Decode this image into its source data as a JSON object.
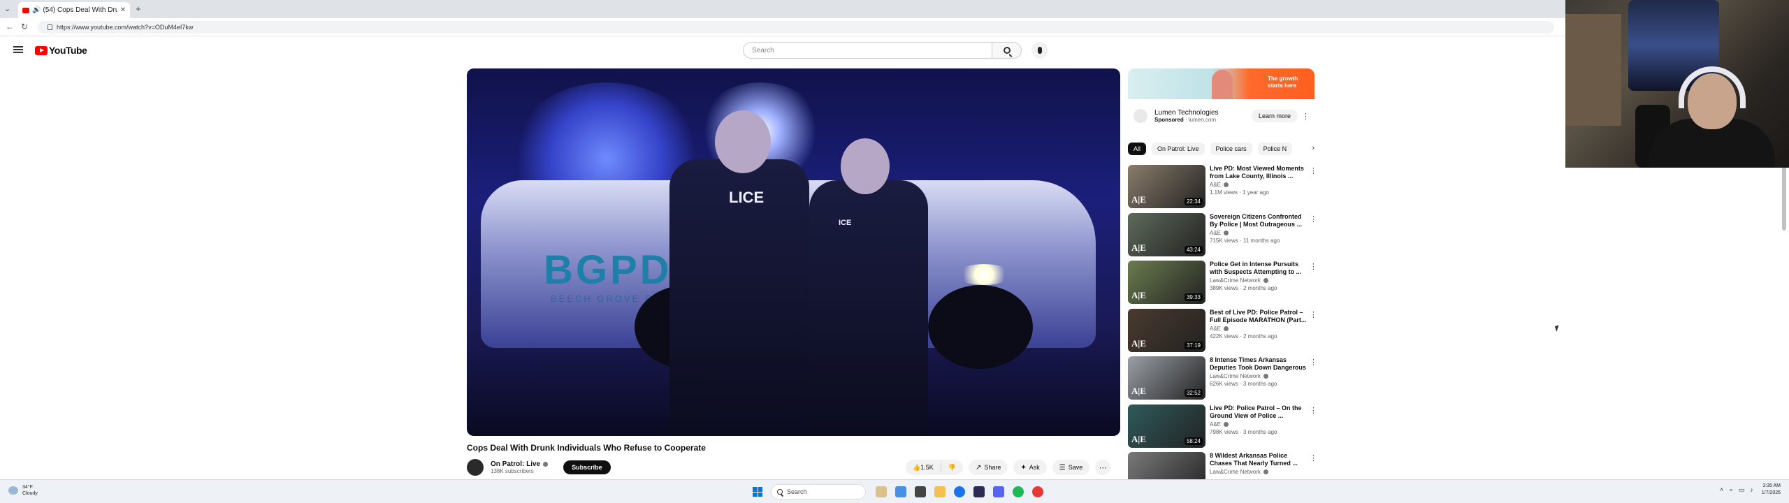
{
  "browser": {
    "tab_title": "(54) Cops Deal With Drunk Individuals Who Refuse to Cooperate",
    "url": "https://www.youtube.com/watch?v=ODuM4eI7kw"
  },
  "header": {
    "logo_text": "YouTube",
    "search_placeholder": "Search"
  },
  "video": {
    "title": "Cops Deal With Drunk Individuals Who Refuse to Cooperate",
    "channel": "On Patrol: Live",
    "subscribers": "138K subscribers",
    "subscribe_label": "Subscribe",
    "likes": "1.5K",
    "share_label": "Share",
    "ask_label": "Ask",
    "save_label": "Save",
    "frame_decal": "BGPD",
    "frame_decal_sub": "BEECH GROVE POLICE",
    "frame_badge_1": "LICE",
    "frame_badge_2": "ICE"
  },
  "ad": {
    "tagline": "The growth starts here",
    "name": "Lumen Technologies",
    "sponsored": "Sponsored",
    "domain": "lumen.com",
    "cta": "Learn more"
  },
  "chips": [
    "All",
    "On Patrol: Live",
    "Police cars",
    "Police N"
  ],
  "recommendations": [
    {
      "title": "Live PD: Most Viewed Moments from Lake County, Illinois ...",
      "channel": "A&E",
      "stats": "1.1M views · 1 year ago",
      "duration": "22:34",
      "thumb": "#8a7d6b"
    },
    {
      "title": "Sovereign Citizens Confronted By Police | Most Outrageous ...",
      "channel": "A&E",
      "stats": "715K views · 11 months ago",
      "duration": "43:24",
      "thumb": "#5e6a5a"
    },
    {
      "title": "Police Get in Intense Pursuits with Suspects Attempting to ...",
      "channel": "Law&Crime Network",
      "stats": "389K views · 2 months ago",
      "duration": "39:33",
      "thumb": "#6a7c4e"
    },
    {
      "title": "Best of Live PD: Police Patrol – Full Episode MARATHON (Part...",
      "channel": "A&E",
      "stats": "422K views · 2 months ago",
      "duration": "37:19",
      "thumb": "#4a3a2e"
    },
    {
      "title": "8 Intense Times Arkansas Deputies Took Down Dangerous ...",
      "channel": "Law&Crime Network",
      "stats": "626K views · 3 months ago",
      "duration": "32:52",
      "thumb": "#9aa0a6"
    },
    {
      "title": "Live PD: Police Patrol – On the Ground View of Police ...",
      "channel": "A&E",
      "stats": "798K views · 3 months ago",
      "duration": "58:24",
      "thumb": "#2f5a5c"
    },
    {
      "title": "8 Wildest Arkansas Police Chases That Nearly Turned ...",
      "channel": "Law&Crime Network",
      "stats": "",
      "duration": "",
      "thumb": "#7a7a7a"
    }
  ],
  "taskbar": {
    "weather_temp": "34°F",
    "weather_desc": "Cloudy",
    "search_label": "Search",
    "time": "3:35 AM",
    "date": "1/7/2025"
  }
}
